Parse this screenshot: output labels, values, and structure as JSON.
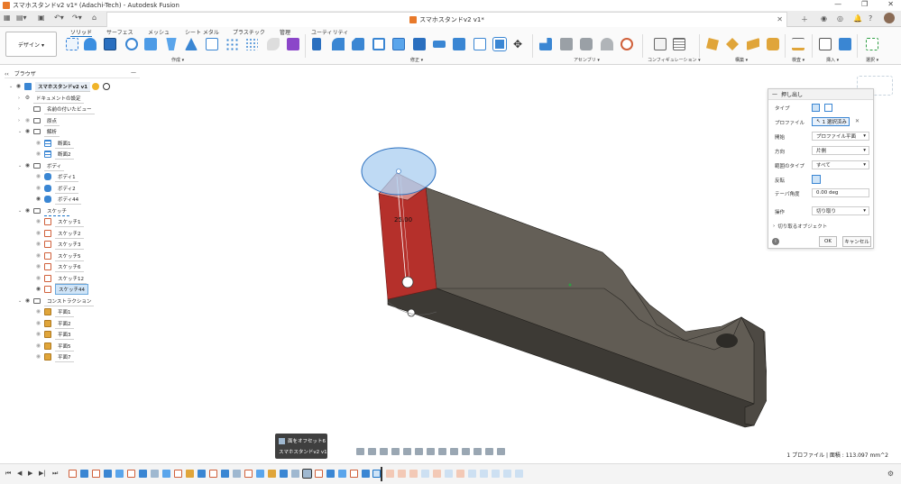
{
  "window": {
    "title": "スマホスタンドv2 v1* (Adachi-Tech) - Autodesk Fusion",
    "controls": [
      "—",
      "❐",
      "✕"
    ]
  },
  "document_tab": {
    "label": "スマホスタンドv2 v1*"
  },
  "ribbon": {
    "workspace_button": "デザイン ▾",
    "tabs": [
      "ソリッド",
      "サーフェス",
      "メッシュ",
      "シート メタル",
      "プラスチック",
      "管理",
      "ユーティリティ"
    ],
    "groups": [
      "作成 ▾",
      "修正 ▾",
      "アセンブリ ▾",
      "コンフィギュレーション ▾",
      "構築 ▾",
      "検査 ▾",
      "挿入 ▾",
      "選択 ▾"
    ]
  },
  "browser": {
    "title": "ブラウザ",
    "items": [
      {
        "label": "スマホスタンドv2 v1",
        "level": 0
      },
      {
        "label": "ドキュメントの設定",
        "level": 1
      },
      {
        "label": "名前の付いたビュー",
        "level": 1
      },
      {
        "label": "原点",
        "level": 1
      },
      {
        "label": "解析",
        "level": 1
      },
      {
        "label": "断面1",
        "level": 2
      },
      {
        "label": "断面2",
        "level": 2
      },
      {
        "label": "ボディ",
        "level": 1
      },
      {
        "label": "ボディ1",
        "level": 2
      },
      {
        "label": "ボディ2",
        "level": 2
      },
      {
        "label": "ボディ44",
        "level": 2
      },
      {
        "label": "スケッチ",
        "level": 1
      },
      {
        "label": "スケッチ1",
        "level": 2
      },
      {
        "label": "スケッチ2",
        "level": 2
      },
      {
        "label": "スケッチ3",
        "level": 2
      },
      {
        "label": "スケッチ5",
        "level": 2
      },
      {
        "label": "スケッチ6",
        "level": 2
      },
      {
        "label": "スケッチ12",
        "level": 2
      },
      {
        "label": "スケッチ44",
        "level": 2
      },
      {
        "label": "コンストラクション",
        "level": 1
      },
      {
        "label": "平面1",
        "level": 2
      },
      {
        "label": "平面2",
        "level": 2
      },
      {
        "label": "平面3",
        "level": 2
      },
      {
        "label": "平面5",
        "level": 2
      },
      {
        "label": "平面7",
        "level": 2
      }
    ]
  },
  "viewport": {
    "dimension_value": "25.00"
  },
  "extrude_panel": {
    "title": "押し出し",
    "rows": [
      {
        "label": "タイプ",
        "value": ""
      },
      {
        "label": "プロファイル",
        "value": "1 選択済み"
      },
      {
        "label": "開始",
        "value": "プロファイル平面"
      },
      {
        "label": "方向",
        "value": "片側"
      },
      {
        "label": "範囲のタイプ",
        "value": "すべて"
      },
      {
        "label": "反転",
        "value": ""
      },
      {
        "label": "テーパ角度",
        "value": "0.00 deg"
      },
      {
        "label": "操作",
        "value": "切り取り"
      }
    ],
    "collapsible": "切り取るオブジェクト",
    "ok": "OK",
    "cancel": "キャンセル"
  },
  "tooltip": {
    "line1": "面をオフセット6",
    "line2": "スマホスタンドv2 v1"
  },
  "status": {
    "text": "1 プロファイル | 面積 : 113.097 mm^2"
  },
  "colors": {
    "accent": "#1a73c7",
    "body_dark": "#4b4740",
    "body_top": "#625d55",
    "cut_red": "#b5302b",
    "circle_fill": "#a9cdf0"
  }
}
